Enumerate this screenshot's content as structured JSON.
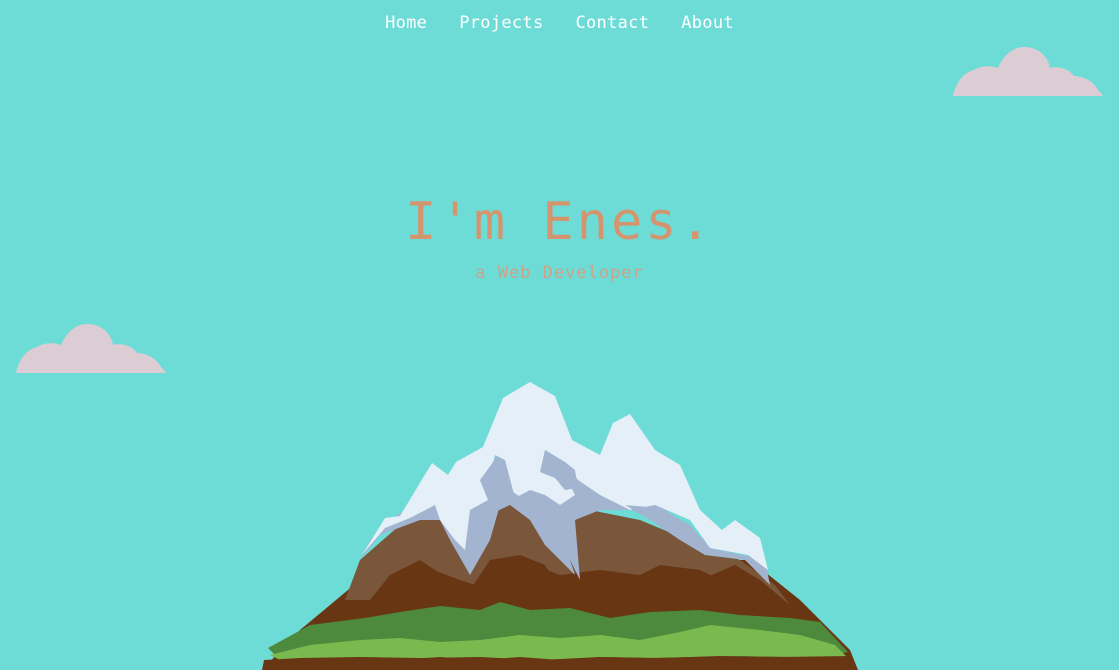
{
  "nav": {
    "items": [
      {
        "label": "Home"
      },
      {
        "label": "Projects"
      },
      {
        "label": "Contact"
      },
      {
        "label": "About"
      }
    ]
  },
  "hero": {
    "title": "I'm Enes.",
    "subtitle": "a Web Developer"
  },
  "colors": {
    "sky": "#6ddcd7",
    "cloud": "#dccdd5",
    "title": "#d4956e",
    "subtitle": "#cfa287",
    "snow": "#e4eff8",
    "snow_shadow": "#a2b4cf",
    "rock_light": "#7a573a",
    "rock_dark": "#683613",
    "grass_dark": "#4d8a3e",
    "grass_light": "#7ab94e"
  },
  "icons": {
    "cloud_left": "cloud-icon",
    "cloud_right": "cloud-icon",
    "mountain": "mountain-illustration"
  }
}
